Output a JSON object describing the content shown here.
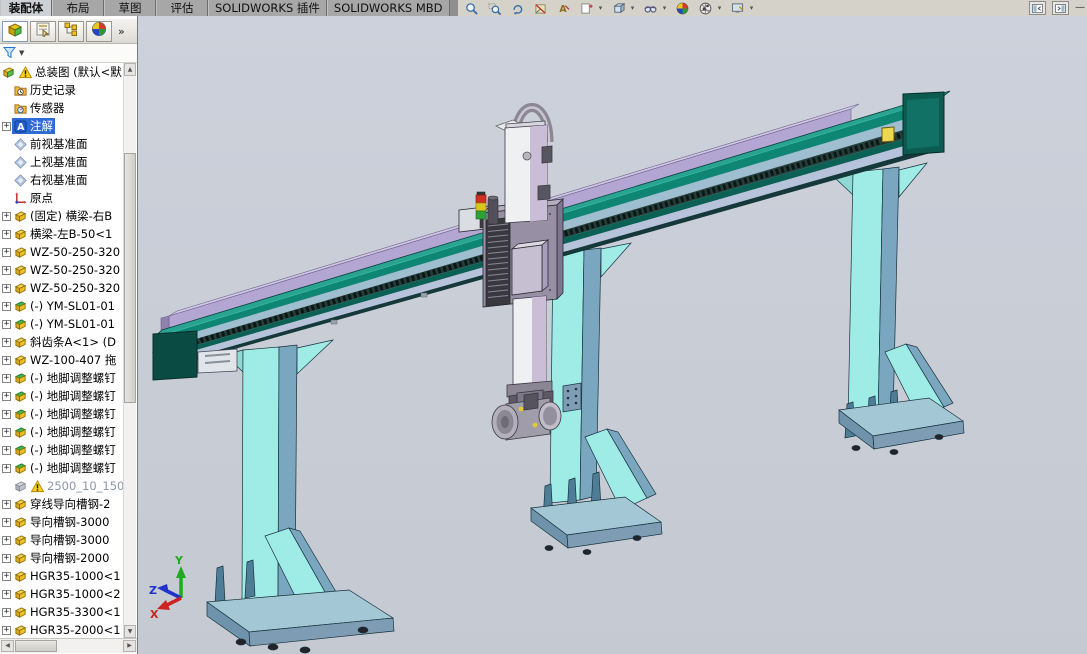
{
  "ribbon": {
    "tabs": [
      {
        "label": "装配体",
        "active": true
      },
      {
        "label": "布局",
        "active": false
      },
      {
        "label": "草图",
        "active": false
      },
      {
        "label": "评估",
        "active": false
      },
      {
        "label": "SOLIDWORKS 插件",
        "active": false
      },
      {
        "label": "SOLIDWORKS MBD",
        "active": false
      }
    ]
  },
  "headsup_toolbar": {
    "icons": [
      {
        "name": "zoom-to-fit-icon",
        "dropdown": false
      },
      {
        "name": "zoom-to-area-icon",
        "dropdown": false
      },
      {
        "name": "rotate-view-icon",
        "dropdown": false
      },
      {
        "name": "section-view-icon",
        "dropdown": false
      },
      {
        "name": "annotation-view-icon",
        "dropdown": false
      },
      {
        "name": "new-view-icon",
        "dropdown": true
      },
      {
        "name": "view-orientation-icon",
        "dropdown": true
      },
      {
        "name": "hide-show-items-icon",
        "dropdown": true
      },
      {
        "name": "edit-appearance-icon",
        "dropdown": false
      },
      {
        "name": "apply-scene-icon",
        "dropdown": true
      },
      {
        "name": "view-settings-icon",
        "dropdown": true
      }
    ]
  },
  "window_controls": {
    "buttons": [
      {
        "name": "collapse-pane-left-button"
      },
      {
        "name": "collapse-pane-right-button"
      }
    ],
    "minimize_label": "—"
  },
  "panel": {
    "tabs": [
      {
        "name": "featuremanager-tab",
        "icon": "featuremanager-icon",
        "active": true
      },
      {
        "name": "propertymanager-tab",
        "icon": "propertymanager-icon",
        "active": false
      },
      {
        "name": "configurationmanager-tab",
        "icon": "configmanager-icon",
        "active": false
      },
      {
        "name": "displaymanager-tab",
        "icon": "displaymanager-icon",
        "active": false
      }
    ],
    "overflow_label": "»",
    "filter": {
      "icon": "funnel-icon"
    }
  },
  "tree": {
    "items": [
      {
        "label": "总装图 (默认<默",
        "icon": "assembly-icon",
        "root": true,
        "warning": true,
        "expander": false,
        "selected": false,
        "grayed": false
      },
      {
        "label": "历史记录",
        "icon": "history-folder-icon",
        "expander": false,
        "selected": false,
        "grayed": false
      },
      {
        "label": "传感器",
        "icon": "sensors-folder-icon",
        "expander": false,
        "selected": false,
        "grayed": false
      },
      {
        "label": "注解",
        "icon": "annotations-icon",
        "expander": true,
        "selected": true,
        "grayed": false
      },
      {
        "label": "前视基准面",
        "icon": "plane-icon",
        "expander": false,
        "selected": false,
        "grayed": false
      },
      {
        "label": "上视基准面",
        "icon": "plane-icon",
        "expander": false,
        "selected": false,
        "grayed": false
      },
      {
        "label": "右视基准面",
        "icon": "plane-icon",
        "expander": false,
        "selected": false,
        "grayed": false
      },
      {
        "label": "原点",
        "icon": "origin-icon",
        "expander": false,
        "selected": false,
        "grayed": false
      },
      {
        "label": "(固定) 横梁-右B",
        "icon": "part-icon",
        "expander": true,
        "selected": false,
        "grayed": false
      },
      {
        "label": "横梁-左B-50<1",
        "icon": "part-icon",
        "expander": true,
        "selected": false,
        "grayed": false
      },
      {
        "label": "WZ-50-250-320",
        "icon": "part-icon",
        "expander": true,
        "selected": false,
        "grayed": false
      },
      {
        "label": "WZ-50-250-320",
        "icon": "part-icon",
        "expander": true,
        "selected": false,
        "grayed": false
      },
      {
        "label": "WZ-50-250-320",
        "icon": "part-icon",
        "expander": true,
        "selected": false,
        "grayed": false
      },
      {
        "label": "(-) YM-SL01-01",
        "icon": "part-green-icon",
        "expander": true,
        "selected": false,
        "grayed": false
      },
      {
        "label": "(-) YM-SL01-01",
        "icon": "part-green-icon",
        "expander": true,
        "selected": false,
        "grayed": false
      },
      {
        "label": "斜齿条A<1> (D",
        "icon": "part-icon",
        "expander": true,
        "selected": false,
        "grayed": false
      },
      {
        "label": "WZ-100-407 拖",
        "icon": "part-icon",
        "expander": true,
        "selected": false,
        "grayed": false
      },
      {
        "label": "(-) 地脚调整螺钉",
        "icon": "part-green-icon",
        "expander": true,
        "selected": false,
        "grayed": false
      },
      {
        "label": "(-) 地脚调整螺钉",
        "icon": "part-green-icon",
        "expander": true,
        "selected": false,
        "grayed": false
      },
      {
        "label": "(-) 地脚调整螺钉",
        "icon": "part-green-icon",
        "expander": true,
        "selected": false,
        "grayed": false
      },
      {
        "label": "(-) 地脚调整螺钉",
        "icon": "part-green-icon",
        "expander": true,
        "selected": false,
        "grayed": false
      },
      {
        "label": "(-) 地脚调整螺钉",
        "icon": "part-green-icon",
        "expander": true,
        "selected": false,
        "grayed": false
      },
      {
        "label": "(-) 地脚调整螺钉",
        "icon": "part-green-icon",
        "expander": true,
        "selected": false,
        "grayed": false
      },
      {
        "label": "2500_10_150",
        "icon": "part-gray-icon",
        "warning": true,
        "expander": false,
        "selected": false,
        "grayed": true
      },
      {
        "label": "穿线导向槽钢-2",
        "icon": "part-icon",
        "expander": true,
        "selected": false,
        "grayed": false
      },
      {
        "label": "导向槽钢-3000",
        "icon": "part-icon",
        "expander": true,
        "selected": false,
        "grayed": false
      },
      {
        "label": "导向槽钢-3000",
        "icon": "part-icon",
        "expander": true,
        "selected": false,
        "grayed": false
      },
      {
        "label": "导向槽钢-2000",
        "icon": "part-icon",
        "expander": true,
        "selected": false,
        "grayed": false
      },
      {
        "label": "HGR35-1000<1",
        "icon": "part-icon",
        "expander": true,
        "selected": false,
        "grayed": false
      },
      {
        "label": "HGR35-1000<2",
        "icon": "part-icon",
        "expander": true,
        "selected": false,
        "grayed": false
      },
      {
        "label": "HGR35-3300<1",
        "icon": "part-icon",
        "expander": true,
        "selected": false,
        "grayed": false
      },
      {
        "label": "HGR35-2000<1",
        "icon": "part-icon",
        "expander": true,
        "selected": false,
        "grayed": false
      }
    ]
  },
  "viewport": {
    "triad": {
      "x_label": "X",
      "y_label": "Y",
      "z_label": "Z"
    },
    "colors": {
      "bg_top": "#cdd1db",
      "bg_bottom": "#c5c9d1",
      "selection": "#2e6bd6",
      "beam_top": "#29a492",
      "beam_face": "#0f8573",
      "beam_face_light": "#9fbecf",
      "rack": "#25403c",
      "beam_dark": "#0c6156",
      "beam_band_light": "#b7c3da",
      "beam_bottom": "#15383a",
      "beam_end": "#0a4c44",
      "tray": "#b3a6d3",
      "tray_top": "#cfc6e2",
      "col_face": "#9febe6",
      "col_side": "#7aa6bf",
      "base_top": "#a3c7d4",
      "base_side": "#7e9db5",
      "carriage": "#978fa3",
      "carriage_top": "#b5aec0",
      "vent": "#39383f",
      "motor": "#c6bfd1",
      "arm_light": "#eef0f2",
      "arm_shade": "#c9bed6",
      "loop": "#8b8794",
      "sig_red": "#d03020",
      "sig_yellow": "#ddc520",
      "sig_green": "#2da03a",
      "triad_x": "#cc2222",
      "triad_y": "#1faa1f",
      "triad_z": "#2233cc"
    }
  }
}
